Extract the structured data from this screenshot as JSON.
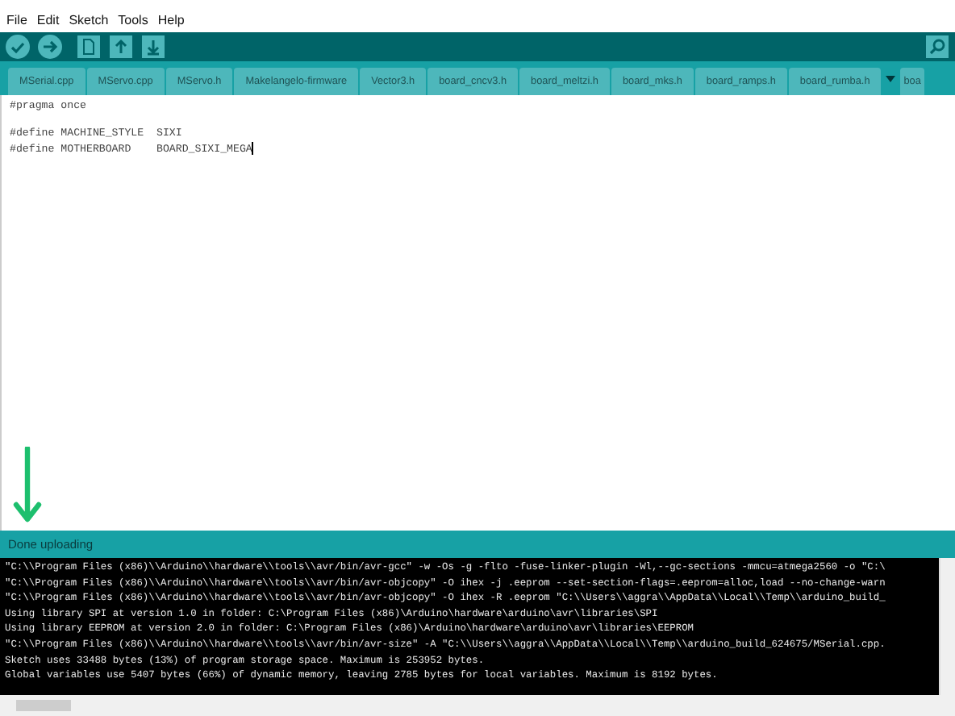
{
  "menu": [
    "File",
    "Edit",
    "Sketch",
    "Tools",
    "Help"
  ],
  "tabs": [
    {
      "label": "MSerial.cpp",
      "selected": false
    },
    {
      "label": "MServo.cpp",
      "selected": false
    },
    {
      "label": "MServo.h",
      "selected": false
    },
    {
      "label": "Makelangelo-firmware",
      "selected": false
    },
    {
      "label": "Vector3.h",
      "selected": false
    },
    {
      "label": "board_cncv3.h",
      "selected": false
    },
    {
      "label": "board_meltzi.h",
      "selected": false
    },
    {
      "label": "board_mks.h",
      "selected": false
    },
    {
      "label": "board_ramps.h",
      "selected": false
    },
    {
      "label": "board_rumba.h",
      "selected": false
    },
    {
      "label": "boa",
      "selected": false
    }
  ],
  "editor": {
    "blocks": [
      [
        "#pragma once"
      ],
      [
        "#define MACHINE_STYLE  SIXI",
        "#define MOTHERBOARD    BOARD_SIXI_MEGA"
      ]
    ]
  },
  "status_bar": {
    "message": "Done uploading"
  },
  "console": {
    "lines": [
      "\"C:\\\\Program Files (x86)\\\\Arduino\\\\hardware\\\\tools\\\\avr/bin/avr-gcc\" -w -Os -g -flto -fuse-linker-plugin -Wl,--gc-sections -mmcu=atmega2560 -o \"C:\\",
      "\"C:\\\\Program Files (x86)\\\\Arduino\\\\hardware\\\\tools\\\\avr/bin/avr-objcopy\" -O ihex -j .eeprom --set-section-flags=.eeprom=alloc,load --no-change-warn",
      "\"C:\\\\Program Files (x86)\\\\Arduino\\\\hardware\\\\tools\\\\avr/bin/avr-objcopy\" -O ihex -R .eeprom \"C:\\\\Users\\\\aggra\\\\AppData\\\\Local\\\\Temp\\\\arduino_build_",
      "Using library SPI at version 1.0 in folder: C:\\Program Files (x86)\\Arduino\\hardware\\arduino\\avr\\libraries\\SPI",
      "Using library EEPROM at version 2.0 in folder: C:\\Program Files (x86)\\Arduino\\hardware\\arduino\\avr\\libraries\\EEPROM",
      "\"C:\\\\Program Files (x86)\\\\Arduino\\\\hardware\\\\tools\\\\avr/bin/avr-size\" -A \"C:\\\\Users\\\\aggra\\\\AppData\\\\Local\\\\Temp\\\\arduino_build_624675/MSerial.cpp.",
      "Sketch uses 33488 bytes (13%) of program storage space. Maximum is 253952 bytes.",
      "Global variables use 5407 bytes (66%) of dynamic memory, leaving 2785 bytes for local variables. Maximum is 8192 bytes."
    ]
  }
}
